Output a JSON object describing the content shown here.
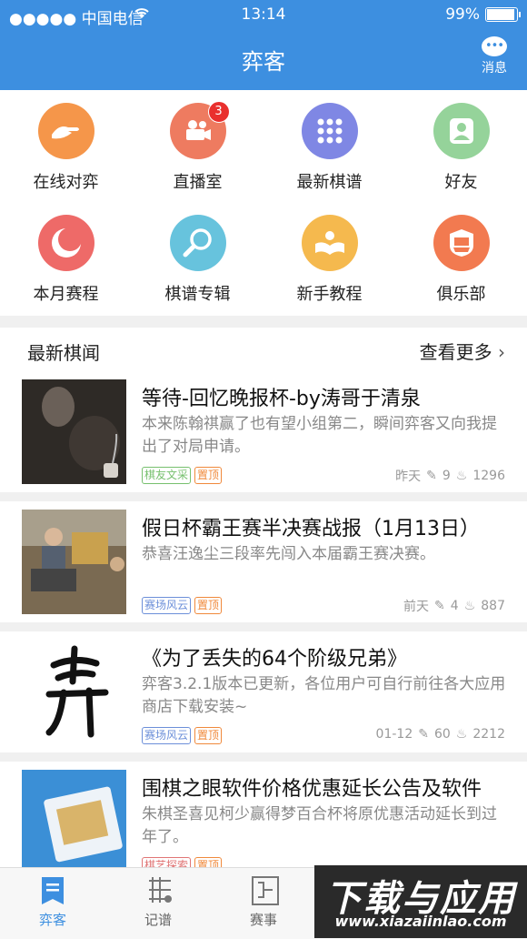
{
  "status": {
    "carrier": "●●●●● 中国电信",
    "time": "13:14",
    "battery": "99%"
  },
  "header": {
    "title": "弈客",
    "message_label": "消息"
  },
  "grid": [
    {
      "label": "在线对弈",
      "color": "#f5964a",
      "icon": "hand-icon"
    },
    {
      "label": "直播室",
      "color": "#ee7b60",
      "icon": "video-camera-icon",
      "badge": "3"
    },
    {
      "label": "最新棋谱",
      "color": "#7f87e4",
      "icon": "dots-grid-icon"
    },
    {
      "label": "好友",
      "color": "#95d39a",
      "icon": "person-icon"
    },
    {
      "label": "本月赛程",
      "color": "#ee6a68",
      "icon": "moon-icon"
    },
    {
      "label": "棋谱专辑",
      "color": "#67c3dd",
      "icon": "magnifier-icon"
    },
    {
      "label": "新手教程",
      "color": "#f5b94e",
      "icon": "reading-book-icon"
    },
    {
      "label": "俱乐部",
      "color": "#f27a50",
      "icon": "shield-icon"
    }
  ],
  "news": {
    "heading": "最新棋闻",
    "more": "查看更多",
    "items": [
      {
        "title": "等待-回忆晚报杯-by涛哥于清泉",
        "desc": "本来陈翰祺赢了也有望小组第二，瞬间弈客又向我提出了对局申请。",
        "tags": [
          "棋友文采",
          "置顶"
        ],
        "time": "昨天",
        "comments": "9",
        "views": "1296"
      },
      {
        "title": "假日杯霸王赛半决赛战报（1月13日）",
        "desc": "恭喜汪逸尘三段率先闯入本届霸王赛决赛。",
        "tags": [
          "赛场风云",
          "置顶"
        ],
        "time": "前天",
        "comments": "4",
        "views": "887"
      },
      {
        "title": "《为了丢失的64个阶级兄弟》",
        "desc": "弈客3.2.1版本已更新，各位用户可自行前往各大应用商店下载安装~",
        "tags": [
          "赛场风云",
          "置顶"
        ],
        "time": "01-12",
        "comments": "60",
        "views": "2212"
      },
      {
        "title": "围棋之眼软件价格优惠延长公告及软件",
        "desc": "朱棋圣喜见柯少赢得梦百合杯将原优惠活动延长到过年了。",
        "tags": [
          "棋艺探索",
          "置顶"
        ],
        "time": "",
        "comments": "",
        "views": ""
      }
    ]
  },
  "tabs": [
    {
      "label": "弈客",
      "active": true
    },
    {
      "label": "记谱",
      "active": false
    },
    {
      "label": "赛事",
      "active": false
    }
  ],
  "watermark": {
    "line1": "下载与应用",
    "line2": "www.xiazaiinlao.com"
  },
  "colors": {
    "brand": "#3d8fe0",
    "tag_green": "#77c06e",
    "tag_orange": "#f0893b",
    "tag_blue": "#6c8fd9",
    "tag_red": "#e07575"
  }
}
